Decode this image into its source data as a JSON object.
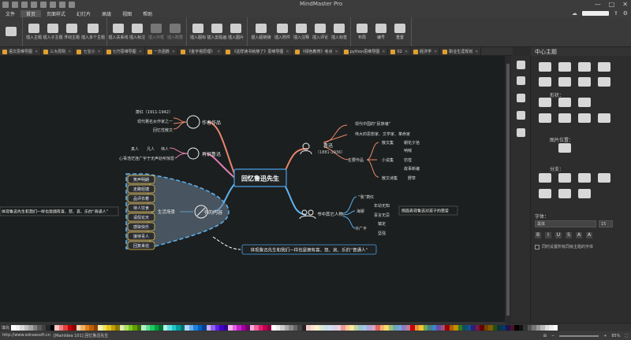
{
  "app": {
    "title": "MindMaster Pro",
    "window_buttons": [
      "—",
      "□",
      "✕"
    ]
  },
  "menu": [
    "文件",
    "首页",
    "页面样式",
    "幻灯片",
    "高级",
    "视图",
    "帮助"
  ],
  "menu_active_index": 1,
  "ribbon": [
    {
      "label": "插入主题"
    },
    {
      "label": "插入子主题"
    },
    {
      "label": "浮动主题"
    },
    {
      "label": "插入多个主题"
    },
    {
      "label": "插入关系线"
    },
    {
      "label": "插入标注"
    },
    {
      "label": "插入外框"
    },
    {
      "label": "插入概要"
    },
    {
      "label": "插入图标"
    },
    {
      "label": "插入剪贴画"
    },
    {
      "label": "插入图片"
    },
    {
      "label": "插入超链接"
    },
    {
      "label": "插入附件"
    },
    {
      "label": "插入注释"
    },
    {
      "label": "插入评论"
    },
    {
      "label": "插入标签"
    },
    {
      "label": "布局"
    },
    {
      "label": "编号"
    },
    {
      "label": "重置"
    }
  ],
  "tabs": [
    "语文思维导图",
    "三大原则",
    "七宝小",
    "七巧思维导图",
    "一次函数",
    "《金字塔原理》",
    "《这样读书就够了》思维导图",
    "《绿色教育》考点",
    "python思维导图",
    "02",
    "经济学",
    "职业生涯规划"
  ],
  "mindmap": {
    "central": "回忆鲁迅先生",
    "branches": {
      "works": "作者作品",
      "works_items": [
        "萧红（1911-1942）",
        "现代著名女作家之一",
        "回忆性散文"
      ],
      "recognize": "再识鲁迅",
      "recognize_items": [
        "真人",
        "凡人",
        "伟人"
      ],
      "recognize_note": "心事浩茫连广宇于无声处听惊雷",
      "content": "书的内容",
      "life": "生活场景",
      "life_items": [
        "笑声明朗",
        "走路轻捷",
        "品评衣着",
        "待人饮食",
        "请侃论天",
        "感染快乐",
        "接待青人",
        "回复来信"
      ],
      "life_note": "体现鲁迅先生和我们一样也是拥有喜、怒、哀、乐的“普通人”",
      "summary": "体现鲁迅先生和我们一样也是拥有喜、怒、哀、乐的“普通人”",
      "luxun": "鲁迅",
      "luxun_years": "（1881-1936）",
      "luxun_items": [
        "现代中国的“民族魂”",
        "伟大的思想家、文学家、革命家"
      ],
      "main_works": "主要作品",
      "prose": "散文集",
      "prose_items": [
        "朝花夕拾"
      ],
      "novel": "小说集",
      "novel_items": [
        "呐喊",
        "彷徨",
        "故事新编"
      ],
      "poem": "散文诗集",
      "poem_items": [
        "野草"
      ],
      "other": "书中其它人物",
      "other_intro": "“我”萧红",
      "haiying": "海婴",
      "haiying_items": [
        "年幼无知",
        "喜言无忌"
      ],
      "haiying_note": "侧面表现鲁迅对孩子的慈爱",
      "xu": "许广平",
      "xu_items": [
        "镇定",
        "坚强"
      ]
    }
  },
  "panel": {
    "title": "中心主题",
    "labels": [
      "形状：",
      "图片位置：",
      "分支：",
      "字体："
    ],
    "font": "黑体",
    "font_size": "15",
    "format_buttons": [
      "B",
      "I",
      "U",
      "S",
      "A",
      "A"
    ],
    "checkbox_label": "同时设置所有同级主题的字体"
  },
  "palette": {
    "label": "填充",
    "colors": [
      "#ffffff",
      "#f2f2f2",
      "#d9d9d9",
      "#bfbfbf",
      "#a6a6a6",
      "#808080",
      "#595959",
      "#404040",
      "#262626",
      "#000000",
      "#f8c4c4",
      "#f08080",
      "#e04040",
      "#c00000",
      "#900000",
      "#f8d8b0",
      "#f0b060",
      "#e08020",
      "#c06000",
      "#904000",
      "#f8f0b0",
      "#f0e060",
      "#e0c820",
      "#c0a000",
      "#907800",
      "#d8f0b0",
      "#b0e060",
      "#80c820",
      "#60a000",
      "#407000",
      "#b0f0c8",
      "#60e090",
      "#20c860",
      "#00a040",
      "#007030",
      "#b0f0f0",
      "#60e0e0",
      "#20c8c8",
      "#00a0a0",
      "#007070",
      "#b0d8f8",
      "#60b0f0",
      "#2080e0",
      "#0060c0",
      "#004090",
      "#c8b0f8",
      "#9060f0",
      "#6020e0",
      "#4000c0",
      "#300090",
      "#f0b0f0",
      "#e060e0",
      "#c820c8",
      "#a000a0",
      "#700070",
      "#f8b0d0",
      "#f060a0",
      "#e02070",
      "#c00050",
      "#900040",
      "#ffffff",
      "#ececec",
      "#cccccc",
      "#aaaaaa",
      "#888888",
      "#666666",
      "#444444",
      "#222222",
      "#f4cccc",
      "#fce5cd",
      "#fff2cc",
      "#d9ead3",
      "#d0e0e3",
      "#cfe2f3",
      "#d9d2e9",
      "#ead1dc",
      "#ea9999",
      "#f9cb9c",
      "#ffe599",
      "#b6d7a8",
      "#a2c4c9",
      "#9fc5e8",
      "#b4a7d6",
      "#d5a6bd",
      "#e06666",
      "#f6b26b",
      "#ffd966",
      "#93c47d",
      "#76a5af",
      "#6fa8dc",
      "#8e7cc3",
      "#c27ba0",
      "#cc0000",
      "#e69138",
      "#f1c232",
      "#6aa84f",
      "#45818e",
      "#3d85c6",
      "#674ea7",
      "#a64d79",
      "#990000",
      "#b45f06",
      "#bf9000",
      "#38761d",
      "#134f5c",
      "#0b5394",
      "#351c75",
      "#741b47",
      "#660000",
      "#783f04",
      "#7f6000",
      "#274e13",
      "#0c343d",
      "#073763",
      "#20124d",
      "#4c1130",
      "#000000",
      "#111111",
      "#333333",
      "#555555",
      "#777777",
      "#999999",
      "#bbbbbb",
      "#dddddd",
      "#eeeeee",
      "#ffffff"
    ]
  },
  "status": {
    "url": "http://www.edrawsoft.cn",
    "info": "[MainIdea 101] 回忆鲁迅先生",
    "zoom": "85%"
  }
}
